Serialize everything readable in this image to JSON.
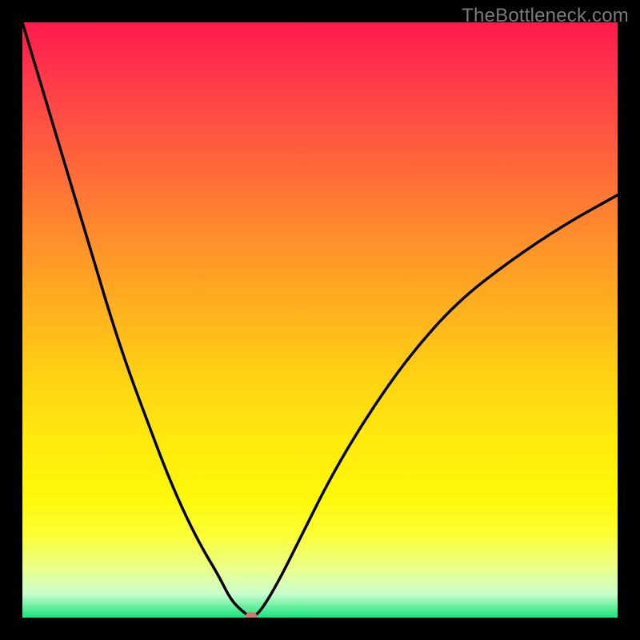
{
  "attribution": "TheBottleneck.com",
  "colors": {
    "frame": "#000000",
    "attribution_text": "#7a7a7a",
    "curve": "#000000",
    "marker": "#cc7b6b",
    "gradient_stops": [
      "#ff1a4d",
      "#ff3b4a",
      "#ff5a3f",
      "#ff7a33",
      "#ff9a27",
      "#ffb61c",
      "#ffd313",
      "#ffea0e",
      "#fff80a",
      "#fbff33",
      "#eaff8e",
      "#c9ffcf",
      "#15e47a"
    ]
  },
  "chart_data": {
    "type": "line",
    "title": "",
    "xlabel": "",
    "ylabel": "",
    "xlim": [
      0,
      100
    ],
    "ylim": [
      0,
      100
    ],
    "grid": false,
    "legend": false,
    "series": [
      {
        "name": "bottleneck-curve",
        "x": [
          0,
          3,
          6,
          9,
          12,
          15,
          18,
          21,
          24,
          27,
          30,
          33,
          35,
          37,
          38.5,
          40,
          43,
          47,
          52,
          58,
          65,
          73,
          82,
          91,
          100
        ],
        "y": [
          100,
          90,
          80,
          70,
          60,
          50,
          41,
          33,
          25,
          18,
          12,
          7,
          3,
          1,
          0,
          1,
          6,
          14,
          24,
          34,
          44,
          53,
          60,
          66,
          71
        ]
      }
    ],
    "marker": {
      "x": 38.5,
      "y": 0
    },
    "notes": "x and y are fractional 0-100 of the inner plot area. y=0 is the bottom (green), y=100 is the top (red). Values are visually estimated from pixels."
  }
}
